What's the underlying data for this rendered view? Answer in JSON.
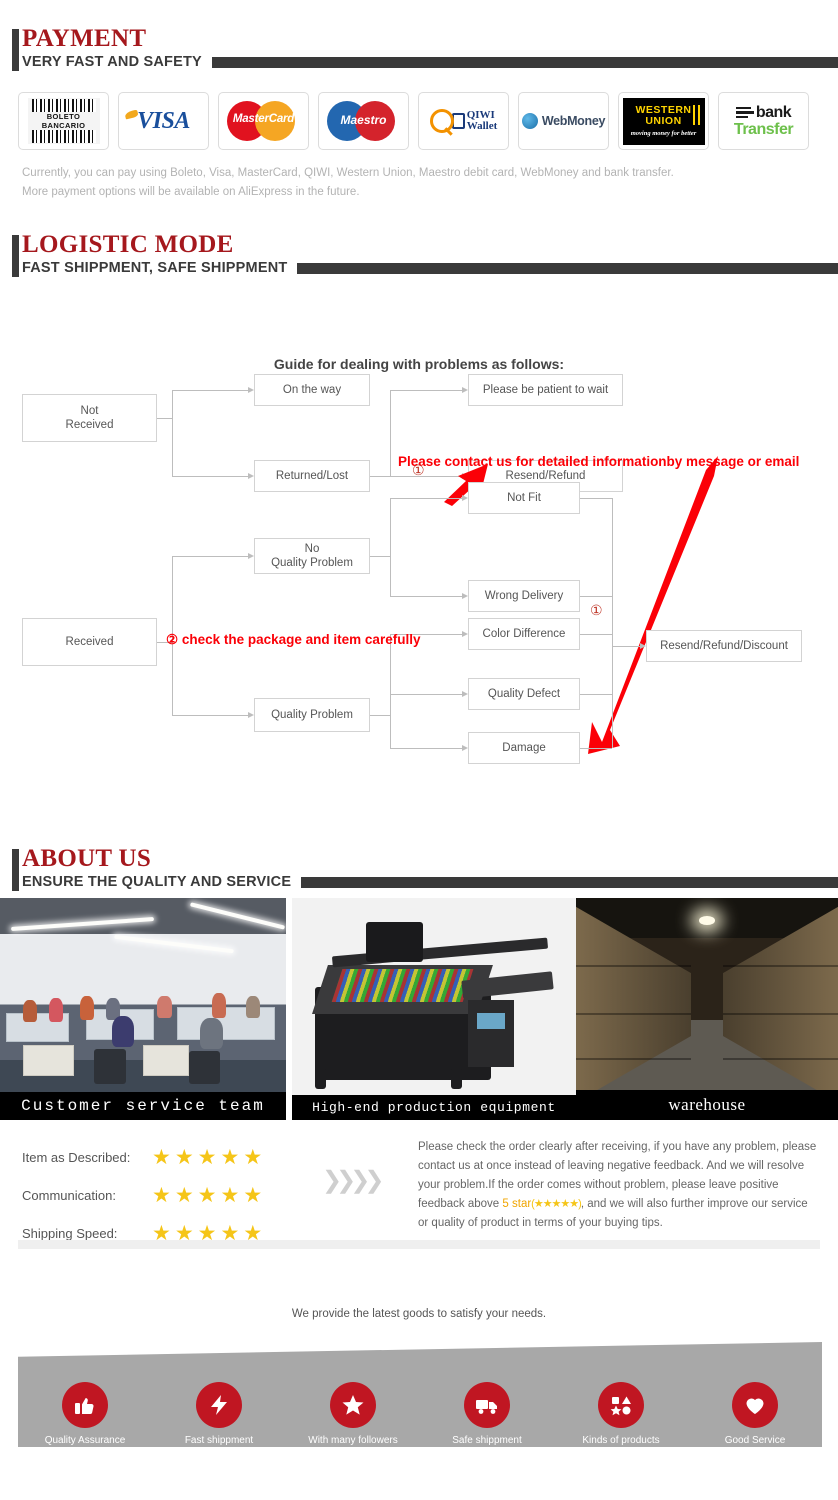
{
  "payment": {
    "title": "PAYMENT",
    "subtitle": "VERY FAST AND SAFETY",
    "methods": [
      {
        "name": "boleto-bancario",
        "line1": "BOLETO",
        "line2": "BANCARIO"
      },
      {
        "name": "visa",
        "label": "VISA"
      },
      {
        "name": "mastercard",
        "label": "MasterCard"
      },
      {
        "name": "maestro",
        "label": "Maestro"
      },
      {
        "name": "qiwi-wallet",
        "line1": "QIWI",
        "line2": "Wallet"
      },
      {
        "name": "webmoney",
        "label": "WebMoney"
      },
      {
        "name": "western-union",
        "line1": "WESTERN",
        "line2": "UNION",
        "line3": "moving money for better"
      },
      {
        "name": "bank-transfer",
        "line1": "bank",
        "line2": "Transfer"
      }
    ],
    "note_line1": "Currently, you can pay using Boleto, Visa, MasterCard, QIWI, Western Union, Maestro debit card, WebMoney and bank transfer.",
    "note_line2": "More payment options will be available on AliExpress in the future."
  },
  "logistic": {
    "title": "LOGISTIC MODE",
    "subtitle": "FAST SHIPPMENT, SAFE SHIPPMENT",
    "flowchart_title": "Guide for dealing with problems as follows:",
    "boxes": {
      "not_received": "Not\nReceived",
      "on_the_way": "On the way",
      "returned_lost": "Returned/Lost",
      "please_wait": "Please be patient to wait",
      "resend_refund": "Resend/Refund",
      "received": "Received",
      "no_quality_problem": "No\nQuality Problem",
      "quality_problem": "Quality Problem",
      "not_fit": "Not Fit",
      "wrong_delivery": "Wrong Delivery",
      "color_difference": "Color Difference",
      "quality_defect": "Quality Defect",
      "damage": "Damage",
      "resend_refund_discount": "Resend/Refund/Discount"
    },
    "annotations": {
      "note1": "Please contact us for detailed informationby message or email",
      "note2": "② check the package and item carefully",
      "marker1": "①",
      "marker2": "①"
    }
  },
  "about": {
    "title": "ABOUT US",
    "subtitle": "ENSURE THE QUALITY AND SERVICE",
    "photos": [
      {
        "name": "customer-service-team",
        "caption": "Customer service team"
      },
      {
        "name": "production-equipment",
        "caption": "High-end production equipment"
      },
      {
        "name": "warehouse",
        "caption": "warehouse"
      }
    ]
  },
  "ratings": {
    "rows": [
      {
        "label": "Item as Described:",
        "stars": 5
      },
      {
        "label": "Communication:",
        "stars": 5
      },
      {
        "label": "Shipping Speed:",
        "stars": 5
      }
    ],
    "star_glyph": "★",
    "star_color": "#f5c518",
    "feedback": {
      "part1": "Please check the order clearly after receiving, if you have any problem, please contact us at once instead of leaving negative feedback. And we will resolve your problem.If the order comes without problem, please leave positive feedback above ",
      "highlight": "5 star",
      "ministars": "(★★★★★)",
      "part2": ", and we will also further improve our service or quality of product in terms of your buying tips."
    }
  },
  "bottom": {
    "tagline": "We provide the latest goods to satisfy your needs.",
    "features": [
      {
        "icon": "thumbs-up-icon",
        "glyph": "👍",
        "label": "Quality Assurance"
      },
      {
        "icon": "lightning-bolt-icon",
        "glyph": "⚡",
        "label": "Fast shippment"
      },
      {
        "icon": "star-icon",
        "glyph": "★",
        "label": "With many followers"
      },
      {
        "icon": "truck-icon",
        "glyph": "🚚",
        "label": "Safe shippment"
      },
      {
        "icon": "shapes-icon",
        "glyph": "◆",
        "label": "Kinds of products"
      },
      {
        "icon": "heart-icon",
        "glyph": "♥",
        "label": "Good Service"
      }
    ],
    "accent_color": "#c01622",
    "band_color": "#a8a8a8"
  }
}
